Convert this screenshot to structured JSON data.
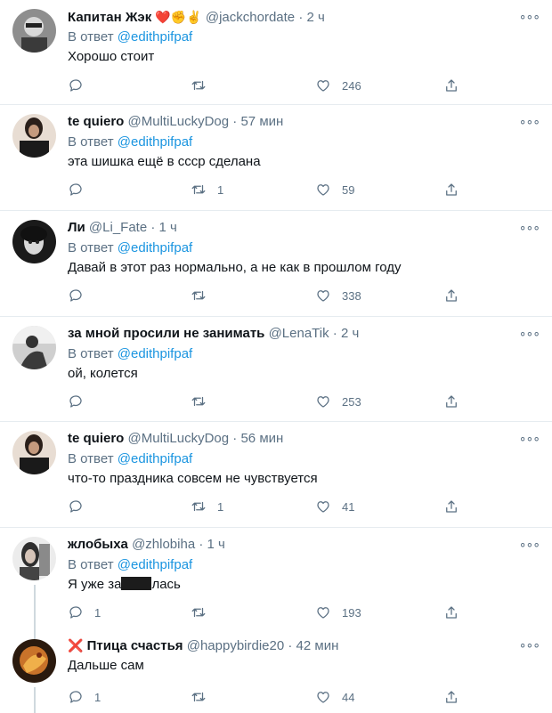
{
  "tweets": [
    {
      "name": "Капитан Жэк",
      "emoji": "❤️✊✌️",
      "handle": "@jackchordate",
      "dot": "·",
      "time": "2 ч",
      "reply_prefix": "В ответ",
      "reply_to": "@edithpifpaf",
      "text": "Хорошо стоит",
      "replies": "",
      "retweets": "",
      "likes": "246"
    },
    {
      "name": "te quiero",
      "emoji": "",
      "handle": "@MultiLuckyDog",
      "dot": "·",
      "time": "57 мин",
      "reply_prefix": "В ответ",
      "reply_to": "@edithpifpaf",
      "text": "эта шишка ещё в ссср сделана",
      "replies": "",
      "retweets": "1",
      "likes": "59"
    },
    {
      "name": "Ли",
      "emoji": "",
      "handle": "@Li_Fate",
      "dot": "·",
      "time": "1 ч",
      "reply_prefix": "В ответ",
      "reply_to": "@edithpifpaf",
      "text": "Давай в этот раз нормально, а не как в прошлом году",
      "replies": "",
      "retweets": "",
      "likes": "338"
    },
    {
      "name": "за мной просили не занимать",
      "emoji": "",
      "handle": "@LenaTik",
      "dot": "·",
      "time": "2 ч",
      "reply_prefix": "В ответ",
      "reply_to": "@edithpifpaf",
      "text": "ой, колется",
      "replies": "",
      "retweets": "",
      "likes": "253"
    },
    {
      "name": "te quiero",
      "emoji": "",
      "handle": "@MultiLuckyDog",
      "dot": "·",
      "time": "56 мин",
      "reply_prefix": "В ответ",
      "reply_to": "@edithpifpaf",
      "text": "что-то праздника совсем не чувствуется",
      "replies": "",
      "retweets": "1",
      "likes": "41"
    },
    {
      "name": "жлобыха",
      "emoji": "",
      "handle": "@zhlobiha",
      "dot": "·",
      "time": "1 ч",
      "reply_prefix": "В ответ",
      "reply_to": "@edithpifpaf",
      "text_before": "Я уже за",
      "text_after": "лась",
      "replies": "1",
      "retweets": "",
      "likes": "193"
    },
    {
      "name": "Птица счастья",
      "emoji": "❌",
      "handle": "@happybirdie20",
      "dot": "·",
      "time": "42 мин",
      "text": "Дальше сам",
      "replies": "1",
      "retweets": "",
      "likes": "44"
    }
  ],
  "more_glyph": "∘∘∘",
  "colors": {
    "text": "#0f1419",
    "muted": "#5b7083",
    "link": "#1b95e0",
    "border": "#e6ecf0"
  },
  "icons": [
    "reply-icon",
    "retweet-icon",
    "like-icon",
    "share-icon",
    "more-icon"
  ]
}
